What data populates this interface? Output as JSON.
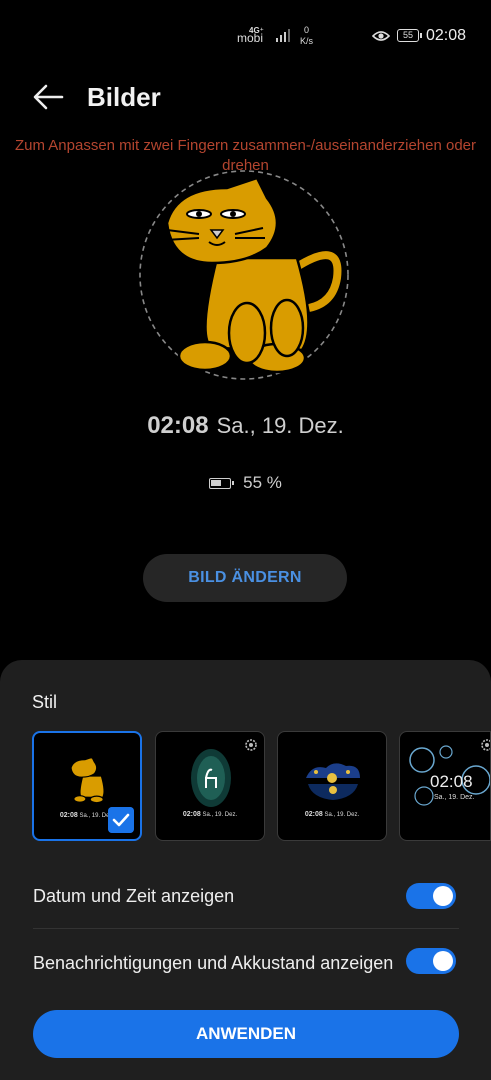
{
  "status_bar": {
    "carrier": "mobi",
    "network": "4G⁺",
    "speed_value": "0",
    "speed_unit": "K/s",
    "battery": "55",
    "time": "02:08"
  },
  "header": {
    "title": "Bilder",
    "hint": "Zum Anpassen mit zwei Fingern zusammen-/auseinanderziehen oder drehen"
  },
  "preview": {
    "time": "02:08",
    "date": "Sa., 19. Dez.",
    "battery": "55 %"
  },
  "change_button": "BILD ÄNDERN",
  "sheet": {
    "style_label": "Stil",
    "thumbs": [
      {
        "name": "cat",
        "time": "02:08",
        "date": "Sa., 19. Dez.",
        "selected": true
      },
      {
        "name": "forest-deer",
        "time": "02:08",
        "date": "Sa., 19. Dez.",
        "selected": false
      },
      {
        "name": "starry-night",
        "time": "02:08",
        "date": "Sa., 19. Dez.",
        "selected": false
      },
      {
        "name": "bubbles",
        "time": "02:08",
        "date": "Sa., 19. Dez.",
        "selected": false
      }
    ],
    "toggle_date_label": "Datum und Zeit anzeigen",
    "toggle_date_on": true,
    "toggle_notif_label": "Benachrichtigungen und Akkustand anzeigen",
    "toggle_notif_on": true,
    "apply_label": "ANWENDEN"
  },
  "colors": {
    "accent": "#1a73e8",
    "hint": "#b4452f",
    "sheet": "#1f1f1f",
    "cat": "#d99c00"
  }
}
